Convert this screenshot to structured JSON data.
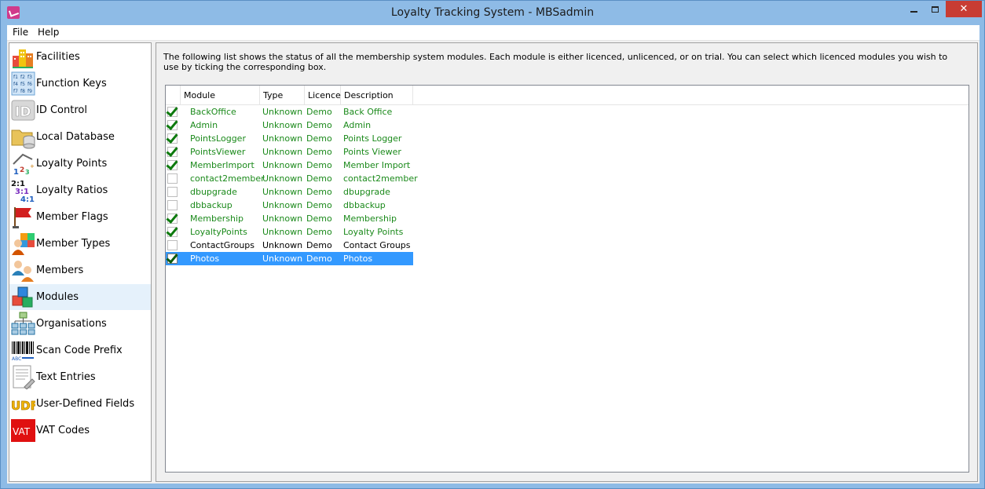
{
  "window": {
    "title": "Loyalty Tracking System - MBSadmin",
    "close_glyph": "✕"
  },
  "menu": [
    "File",
    "Help"
  ],
  "sidebar": {
    "items": [
      {
        "label": "Facilities",
        "icon": "facilities-icon"
      },
      {
        "label": "Function Keys",
        "icon": "function-keys-icon"
      },
      {
        "label": "ID Control",
        "icon": "id-control-icon"
      },
      {
        "label": "Local Database",
        "icon": "local-database-icon"
      },
      {
        "label": "Loyalty Points",
        "icon": "loyalty-points-icon"
      },
      {
        "label": "Loyalty Ratios",
        "icon": "loyalty-ratios-icon"
      },
      {
        "label": "Member Flags",
        "icon": "member-flags-icon"
      },
      {
        "label": "Member Types",
        "icon": "member-types-icon"
      },
      {
        "label": "Members",
        "icon": "members-icon"
      },
      {
        "label": "Modules",
        "icon": "modules-icon",
        "selected": true
      },
      {
        "label": "Organisations",
        "icon": "organisations-icon"
      },
      {
        "label": "Scan Code Prefix",
        "icon": "scan-code-prefix-icon"
      },
      {
        "label": "Text Entries",
        "icon": "text-entries-icon"
      },
      {
        "label": "User-Defined Fields",
        "icon": "user-defined-fields-icon"
      },
      {
        "label": "VAT Codes",
        "icon": "vat-codes-icon"
      }
    ]
  },
  "main": {
    "intro": "The following list shows the status of all the membership system modules. Each module is either licenced, unlicenced, or on trial. You can select which licenced modules you wish to use by ticking the corresponding box.",
    "columns": [
      "Module",
      "Type",
      "Licence",
      "Description"
    ],
    "rows": [
      {
        "checked": true,
        "module": "BackOffice",
        "type": "Unknown",
        "licence": "Demo",
        "description": "Back Office",
        "color": "green"
      },
      {
        "checked": true,
        "module": "Admin",
        "type": "Unknown",
        "licence": "Demo",
        "description": "Admin",
        "color": "green"
      },
      {
        "checked": true,
        "module": "PointsLogger",
        "type": "Unknown",
        "licence": "Demo",
        "description": "Points Logger",
        "color": "green"
      },
      {
        "checked": true,
        "module": "PointsViewer",
        "type": "Unknown",
        "licence": "Demo",
        "description": "Points Viewer",
        "color": "green"
      },
      {
        "checked": true,
        "module": "MemberImport",
        "type": "Unknown",
        "licence": "Demo",
        "description": "Member Import",
        "color": "green"
      },
      {
        "checked": false,
        "module": "contact2member",
        "type": "Unknown",
        "licence": "Demo",
        "description": "contact2member",
        "color": "green"
      },
      {
        "checked": false,
        "module": "dbupgrade",
        "type": "Unknown",
        "licence": "Demo",
        "description": "dbupgrade",
        "color": "green"
      },
      {
        "checked": false,
        "module": "dbbackup",
        "type": "Unknown",
        "licence": "Demo",
        "description": "dbbackup",
        "color": "green"
      },
      {
        "checked": true,
        "module": "Membership",
        "type": "Unknown",
        "licence": "Demo",
        "description": "Membership",
        "color": "green"
      },
      {
        "checked": true,
        "module": "LoyaltyPoints",
        "type": "Unknown",
        "licence": "Demo",
        "description": "Loyalty Points",
        "color": "green"
      },
      {
        "checked": false,
        "module": "ContactGroups",
        "type": "Unknown",
        "licence": "Demo",
        "description": "Contact Groups",
        "color": "black"
      },
      {
        "checked": true,
        "module": "Photos",
        "type": "Unknown",
        "licence": "Demo",
        "description": "Photos",
        "color": "black",
        "selected": true
      }
    ]
  },
  "colors": {
    "licenced_text": "#1b8a1b",
    "selection": "#3399ff",
    "titlebar": "#8ebbe6",
    "close_button": "#c83c33"
  }
}
